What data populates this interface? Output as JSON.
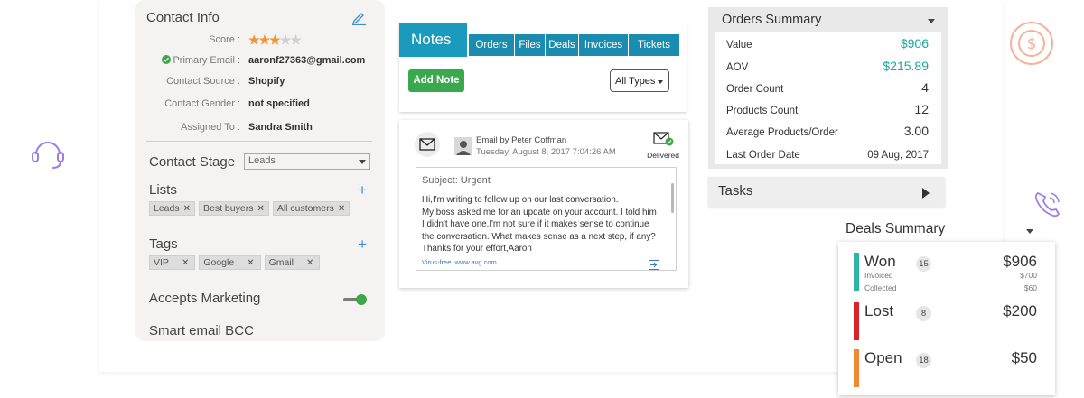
{
  "contact": {
    "title": "Contact Info",
    "score_label": "Score :",
    "score_value": 3,
    "score_max": 5,
    "fields": [
      {
        "label": "Primary Email :",
        "value": "aaronf27363@gmail.com"
      },
      {
        "label": "Contact Source :",
        "value": "Shopify"
      },
      {
        "label": "Contact Gender :",
        "value": "not specified"
      },
      {
        "label": "Assigned To :",
        "value": "Sandra Smith"
      }
    ],
    "stage_label": "Contact Stage",
    "stage_value": "Leads",
    "lists_label": "Lists",
    "lists": [
      "Leads",
      "Best buyers",
      "All customers"
    ],
    "tags_label": "Tags",
    "tags": [
      "VIP",
      "Google",
      "Gmail"
    ],
    "accepts_marketing_label": "Accepts Marketing",
    "accepts_marketing_on": true,
    "smart_bcc_label": "Smart email BCC"
  },
  "notes": {
    "active_tab": "Notes",
    "tabs": [
      "Orders",
      "Files",
      "Deals",
      "Invoices",
      "Tickets"
    ],
    "add_button": "Add Note",
    "filter_value": "All Types"
  },
  "email": {
    "from": "Email by Peter Coffman",
    "timestamp": "Tuesday, August 8, 2017 7:04:26 AM",
    "status": "Delivered",
    "subject": "Subject: Urgent",
    "lines": [
      "Hi,I'm writing to follow up on our last conversation.",
      "My boss asked me for an update on your account. I told him",
      "I didn't have one.I'm not sure if it makes sense to continue",
      "the conversation. What makes sense as a next step, if any?",
      "Thanks for your effort,Aaron"
    ],
    "signature": "Virus-free. www.avg.com"
  },
  "orders": {
    "title": "Orders Summary",
    "rows": [
      {
        "label": "Value",
        "value": "$906"
      },
      {
        "label": "AOV",
        "value": "$215.89"
      },
      {
        "label": "Order Count",
        "value": "4"
      },
      {
        "label": "Products Count",
        "value": "12"
      },
      {
        "label": "Average Products/Order",
        "value": "3.00"
      },
      {
        "label": "Last Order Date",
        "value": "09 Aug, 2017"
      }
    ],
    "accent": "#1aa7a5"
  },
  "tasks": {
    "title": "Tasks"
  },
  "deals": {
    "title": "Deals Summary",
    "items": [
      {
        "name": "Won",
        "count": "15",
        "amount": "$906",
        "color": "#2bb5a6",
        "details": [
          {
            "label": "Invoiced",
            "value": "$700"
          },
          {
            "label": "Collected",
            "value": "$60"
          }
        ]
      },
      {
        "name": "Lost",
        "count": "8",
        "amount": "$200",
        "color": "#d9232c",
        "details": []
      },
      {
        "name": "Open",
        "count": "18",
        "amount": "$50",
        "color": "#ef8a32",
        "details": []
      }
    ]
  },
  "icons": {
    "left_deco": "headset-icon",
    "right_top_deco": "dollar-circle-icon",
    "right_mid_deco": "phone-icon"
  }
}
